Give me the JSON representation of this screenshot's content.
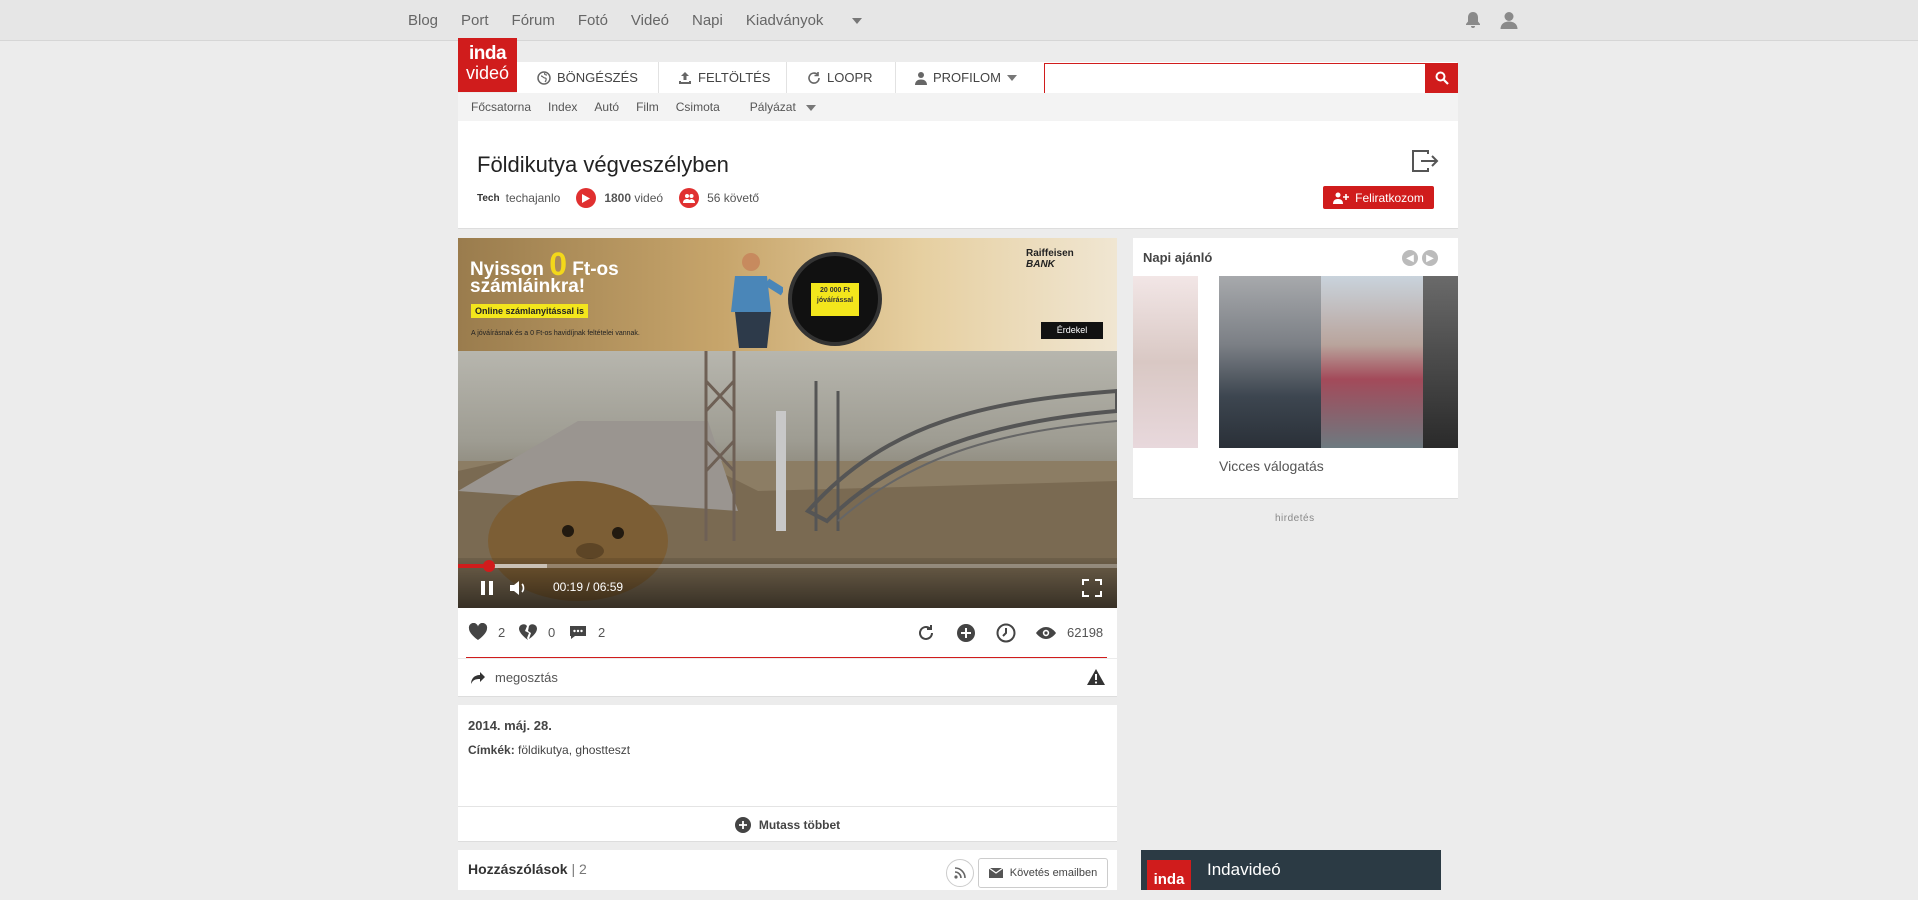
{
  "topnav": {
    "items": [
      "Blog",
      "Port",
      "Fórum",
      "Fotó",
      "Videó",
      "Napi",
      "Kiadványok"
    ]
  },
  "logo": {
    "line1": "inda",
    "line2": "videó"
  },
  "mainnav": {
    "browse": "BÖNGÉSZÉS",
    "upload": "FELTÖLTÉS",
    "loopr": "LOOPR",
    "profile": "PROFILOM"
  },
  "search": {
    "placeholder": ""
  },
  "subnav": {
    "items": [
      "Főcsatorna",
      "Index",
      "Autó",
      "Film",
      "Csimota",
      "Pályázat"
    ]
  },
  "channel": {
    "title": "Földikutya végveszélyben",
    "category": "Tech",
    "user": "techajanlo",
    "video_count": "1800",
    "video_label": "videó",
    "followers": "56 követő",
    "subscribe_label": "Feliratkozom"
  },
  "ad": {
    "line1a": "Nyisson ",
    "zero": "0",
    "line1b": " Ft-os",
    "line2": "számláinkra!",
    "pill": "Online számlanyitással is",
    "small": "A jóváírásnak és a 0 Ft-os havidíjnak feltételei vannak.",
    "disc": "20 000 Ft jóváírással",
    "bank1": "Raiffeisen",
    "bank2": "BANK",
    "cta": "Érdekel"
  },
  "player": {
    "current": "00:19",
    "total": "06:59",
    "progress": 0.045
  },
  "actions": {
    "likes": "2",
    "dislikes": "0",
    "comments": "2",
    "views": "62198",
    "share": "megosztás"
  },
  "description": {
    "date": "2014. máj. 28.",
    "tags_label": "Címkék:",
    "tags": "földikutya, ghostteszt",
    "more": "Mutass többet"
  },
  "comments": {
    "title": "Hozzászólások",
    "count": "| 2",
    "follow_email": "Követés emailben"
  },
  "sidebar": {
    "title": "Napi ajánló",
    "caption": "Vicces válogatás",
    "ad_label": "hirdetés",
    "promo_name": "Indavideó",
    "promo_logo": "inda"
  }
}
